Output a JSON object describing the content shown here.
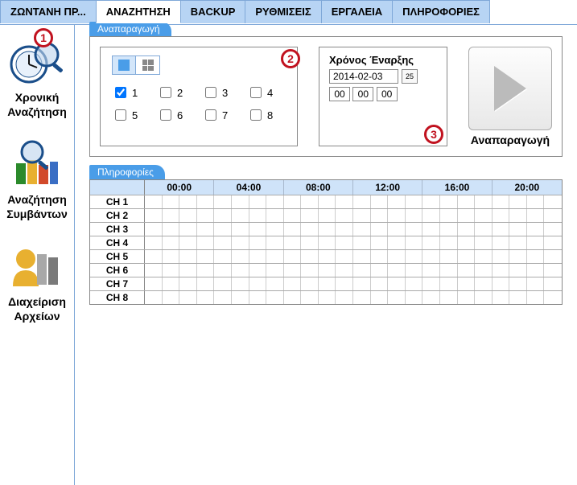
{
  "tabs": [
    "ΖΩΝΤΑΝΗ ΠΡ...",
    "ΑΝΑΖΗΤΗΣΗ",
    "BACKUP",
    "ΡΥΘΜΙΣΕΙΣ",
    "ΕΡΓΑΛΕΙΑ",
    "ΠΛΗΡΟΦΟΡΙΕΣ"
  ],
  "active_tab": 1,
  "sidebar": {
    "items": [
      {
        "label_1": "Χρονική",
        "label_2": "Αναζήτηση"
      },
      {
        "label_1": "Αναζήτηση",
        "label_2": "Συμβάντων"
      },
      {
        "label_1": "Διαχείριση",
        "label_2": "Αρχείων"
      }
    ]
  },
  "playback_panel": {
    "title": "Αναπαραγωγή",
    "channels": [
      {
        "n": "1",
        "checked": true
      },
      {
        "n": "2",
        "checked": false
      },
      {
        "n": "3",
        "checked": false
      },
      {
        "n": "4",
        "checked": false
      },
      {
        "n": "5",
        "checked": false
      },
      {
        "n": "6",
        "checked": false
      },
      {
        "n": "7",
        "checked": false
      },
      {
        "n": "8",
        "checked": false
      }
    ],
    "start_title": "Χρόνος Έναρξης",
    "date": "2014-02-03",
    "cal_icon": "25",
    "time": {
      "h": "00",
      "m": "00",
      "s": "00"
    },
    "play_label": "Αναπαραγωγή"
  },
  "info_panel": {
    "title": "Πληροφορίες",
    "hours": [
      "00:00",
      "04:00",
      "08:00",
      "12:00",
      "16:00",
      "20:00"
    ],
    "channels": [
      "CH 1",
      "CH 2",
      "CH 3",
      "CH 4",
      "CH 5",
      "CH 6",
      "CH 7",
      "CH 8"
    ]
  },
  "callouts": {
    "c1": "1",
    "c2": "2",
    "c3": "3"
  },
  "chart_data": {
    "type": "table",
    "title": "Πληροφορίες",
    "columns": [
      "00:00",
      "04:00",
      "08:00",
      "12:00",
      "16:00",
      "20:00"
    ],
    "rows": [
      "CH 1",
      "CH 2",
      "CH 3",
      "CH 4",
      "CH 5",
      "CH 6",
      "CH 7",
      "CH 8"
    ],
    "values": []
  }
}
